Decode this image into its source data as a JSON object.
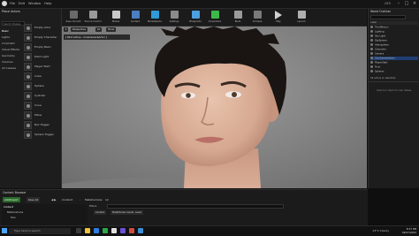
{
  "menubar": {
    "menus": [
      "File",
      "Edit",
      "Window",
      "Help"
    ],
    "window_title": "UE5"
  },
  "toolbar": {
    "items": [
      {
        "label": "Save Current",
        "color": "#6a6a6a"
      },
      {
        "label": "Source Control",
        "color": "#9a9a9a"
      },
      {
        "label": "Modes",
        "color": "#c9c9c9"
      },
      {
        "label": "Content",
        "color": "#4a7fc1"
      },
      {
        "label": "Marketplace",
        "color": "#2e9bd6"
      },
      {
        "label": "Settings",
        "color": "#8a8a8a"
      },
      {
        "label": "Blueprints",
        "color": "#4aa0e0"
      },
      {
        "label": "Cinematics",
        "color": "#3cb84a"
      },
      {
        "label": "Build",
        "color": "#9a9a9a"
      },
      {
        "label": "Compile",
        "color": "#7a7a7a"
      },
      {
        "label": "Play",
        "color": "#d0d0d0"
      },
      {
        "label": "Launch",
        "color": "#b0b0b0"
      }
    ]
  },
  "place_actors": {
    "tab": "Place Actors",
    "search_placeholder": "Search Classes",
    "categories": [
      "Basic",
      "Lights",
      "Cinematic",
      "Visual Effects",
      "Geometry",
      "Volumes",
      "All Classes"
    ],
    "items": [
      "Empty Actor",
      "Empty Character",
      "Empty Pawn",
      "Point Light",
      "Player Start",
      "Cube",
      "Sphere",
      "Cylinder",
      "Cone",
      "Plane",
      "Box Trigger",
      "Sphere Trigger"
    ]
  },
  "viewport": {
    "mode_chip": "Perspective",
    "lit_chip": "Lit",
    "show_chip": "Show",
    "pilot_text": "[ Pilot Active - CineCameraActor ]"
  },
  "outliner": {
    "header": "World Outliner",
    "column_label": "Label",
    "rows": [
      "ThirdPerson",
      "Lighting",
      "Sky Light",
      "SkySphere",
      "Atmosphere",
      "Character",
      "Camera",
      "CineCameraActor",
      "PlayerStart",
      "Floor",
      "Spheres"
    ],
    "selected_row": 7,
    "count_text": "34 actors (1 selected)",
    "details_hint": "Select an object to view details."
  },
  "content_browser": {
    "tab": "Content Browser",
    "add_label": "Add/Import",
    "save_label": "Save All",
    "crumbs": [
      "Content",
      "Metahumans",
      "12"
    ],
    "sidebar": [
      "Content",
      "Metahumans",
      "Taro"
    ],
    "filters_label": "Filters",
    "chips": [
      "Content",
      "MetaHuman Guide",
      "Level"
    ]
  },
  "taskbar": {
    "search_placeholder": "Type here to search",
    "weather": "13°C Cloudy",
    "time": "8:37 PM",
    "date": "02/07/2022"
  }
}
